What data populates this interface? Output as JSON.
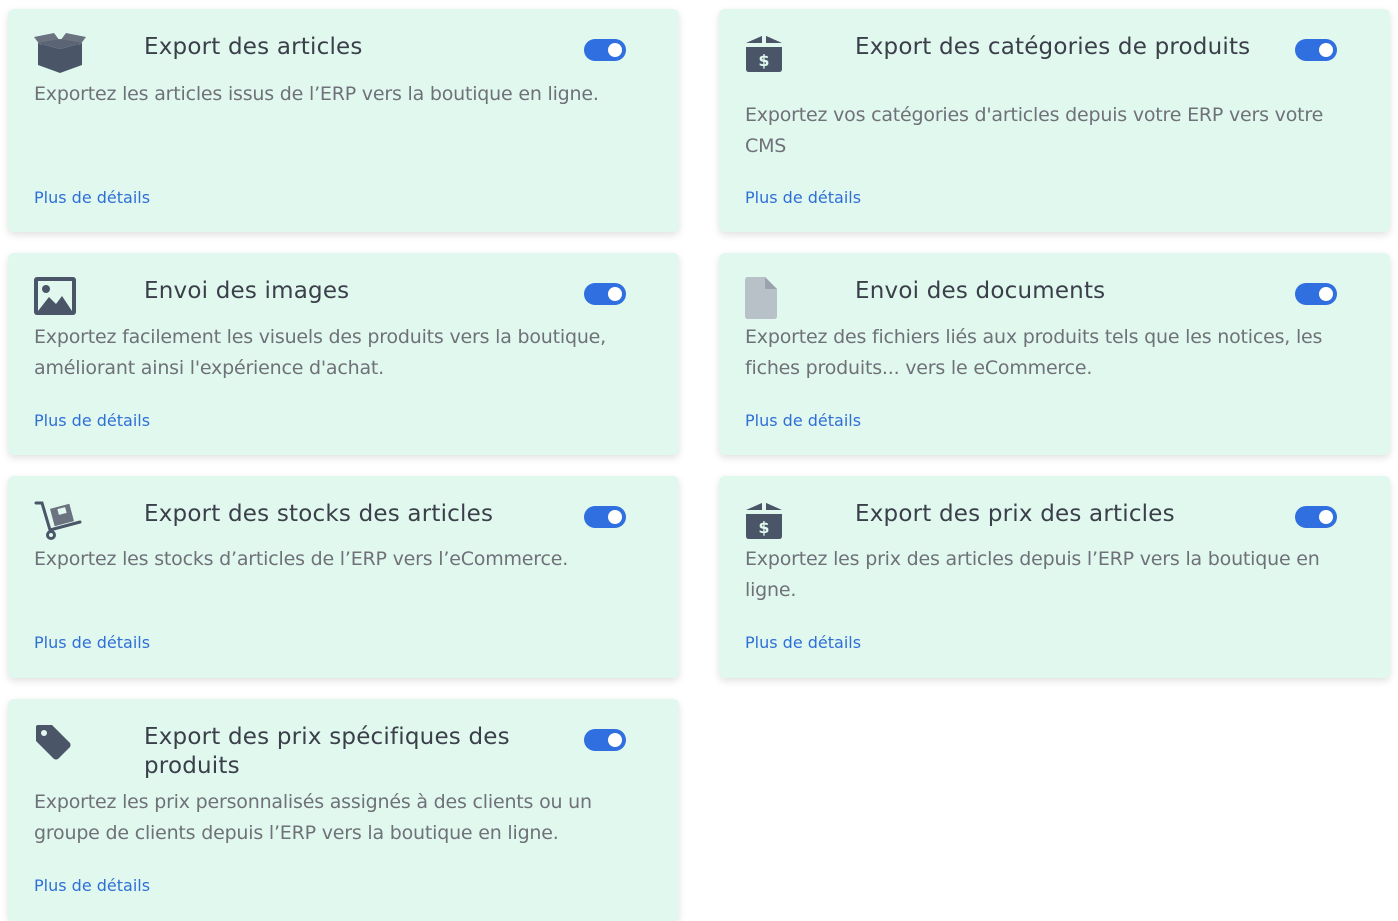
{
  "cards": [
    {
      "icon": "open-box-icon",
      "title": "Export des articles",
      "description": "Exportez les articles issus de l’ERP vers la boutique en ligne.",
      "link": "Plus de détails",
      "enabled": true
    },
    {
      "icon": "price-box-icon",
      "title": "Export des catégories de produits",
      "description": "Exportez vos catégories d'articles depuis votre ERP vers votre CMS",
      "link": "Plus de détails",
      "enabled": true
    },
    {
      "icon": "image-icon",
      "title": "Envoi des images",
      "description": "Exportez facilement les visuels des produits vers la boutique, améliorant ainsi l'expérience d'achat.",
      "link": "Plus de détails",
      "enabled": true
    },
    {
      "icon": "document-icon",
      "title": "Envoi des documents",
      "description": "Exportez des fichiers liés aux produits tels que les notices, les fiches produits... vers le eCommerce.",
      "link": "Plus de détails",
      "enabled": true
    },
    {
      "icon": "hand-truck-icon",
      "title": "Export des stocks des articles",
      "description": "Exportez les stocks d’articles de l’ERP vers l’eCommerce.",
      "link": "Plus de détails",
      "enabled": true
    },
    {
      "icon": "price-box-icon",
      "title": "Export des prix des articles",
      "description": "Exportez les prix des articles depuis l’ERP vers la boutique en ligne.",
      "link": "Plus de détails",
      "enabled": true
    },
    {
      "icon": "tag-icon",
      "title": "Export des prix spécifiques des produits",
      "description": "Exportez les prix personnalisés assignés à des clients ou un groupe de clients depuis l’ERP vers la boutique en ligne.",
      "link": "Plus de détails",
      "enabled": true
    }
  ],
  "colors": {
    "card_bg": "#e1f8ee",
    "toggle_on": "#2f6fe0",
    "link": "#2f6fd8",
    "icon": "#4a5568",
    "title": "#3a3f4a",
    "text": "#6f7178"
  }
}
